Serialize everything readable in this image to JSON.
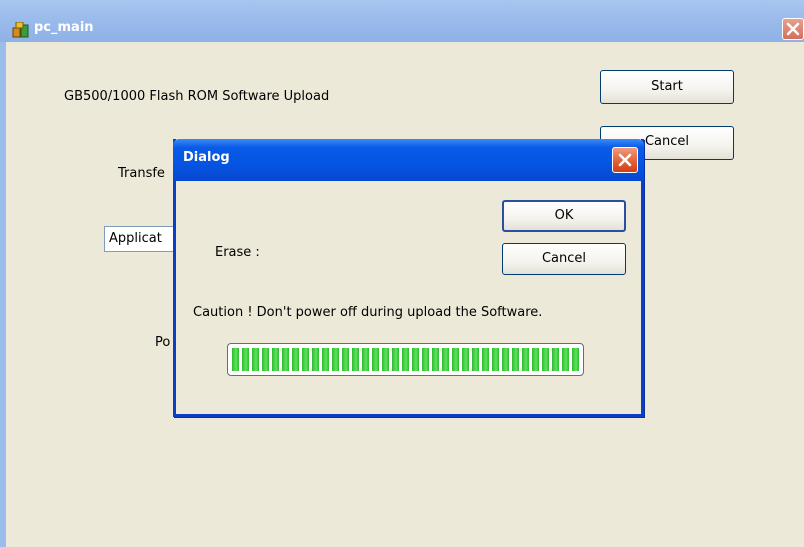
{
  "window": {
    "title": "pc_main",
    "heading": "GB500/1000 Flash ROM Software Upload",
    "start_label": "Start",
    "cancel_label": "Cancel",
    "transfer_label": "Transfe",
    "application_field_value": "Applicat",
    "port_label": "Po"
  },
  "dialog": {
    "title": "Dialog",
    "ok_label": "OK",
    "cancel_label": "Cancel",
    "erase_label": "Erase :",
    "caution_text": "Caution ! Don't power off during upload the Software.",
    "progress": 1.0
  },
  "colors": {
    "progress_green": "#2dbb2d",
    "dialog_title_blue": "#0554e2",
    "close_red": "#e25c32"
  },
  "icons": [
    "app-icon",
    "close-icon"
  ]
}
